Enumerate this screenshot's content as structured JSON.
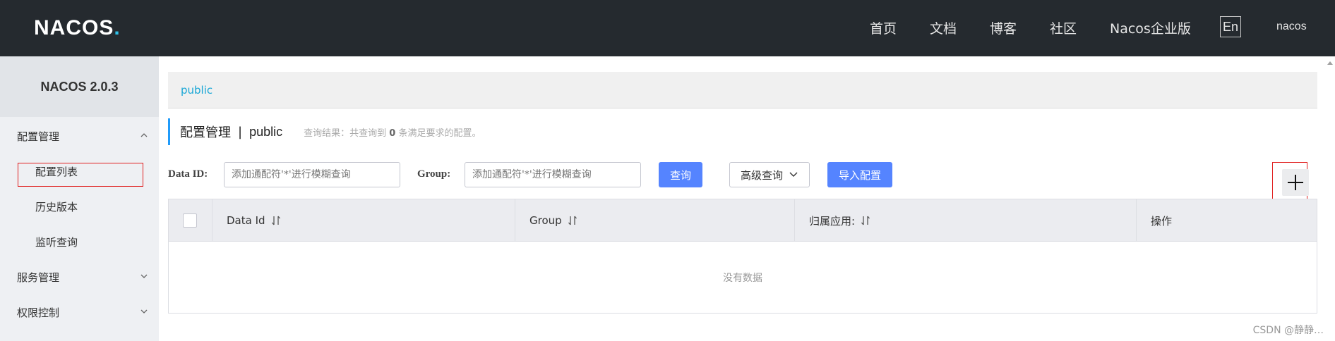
{
  "header": {
    "logo_text": "NACOS",
    "logo_dot": ".",
    "nav": [
      "首页",
      "文档",
      "博客",
      "社区",
      "Nacos企业版"
    ],
    "lang": "En",
    "user": "nacos"
  },
  "sidebar": {
    "version": "NACOS 2.0.3",
    "groups": [
      {
        "label": "配置管理",
        "expanded": true,
        "items": [
          "配置列表",
          "历史版本",
          "监听查询"
        ]
      },
      {
        "label": "服务管理",
        "expanded": false
      },
      {
        "label": "权限控制",
        "expanded": false
      }
    ],
    "selected_item": "配置列表"
  },
  "breadcrumb": "public",
  "title": {
    "main": "配置管理",
    "sep": "|",
    "namespace": "public",
    "hint_prefix": "查询结果：共查询到",
    "hint_count": "0",
    "hint_suffix": "条满足要求的配置。"
  },
  "search": {
    "dataid_label": "Data ID:",
    "dataid_placeholder": "添加通配符'*'进行模糊查询",
    "group_label": "Group:",
    "group_placeholder": "添加通配符'*'进行模糊查询",
    "query_button": "查询",
    "advanced_button": "高级查询",
    "import_button": "导入配置"
  },
  "add_button_icon": "plus-icon",
  "table": {
    "columns": [
      "Data Id",
      "Group",
      "归属应用:",
      "操作"
    ],
    "empty_text": "没有数据"
  },
  "watermark": "CSDN @静静…",
  "colors": {
    "header_bg": "#252a2f",
    "primary": "#5584ff",
    "link": "#1aa7d6",
    "highlight_border": "#e02020"
  }
}
